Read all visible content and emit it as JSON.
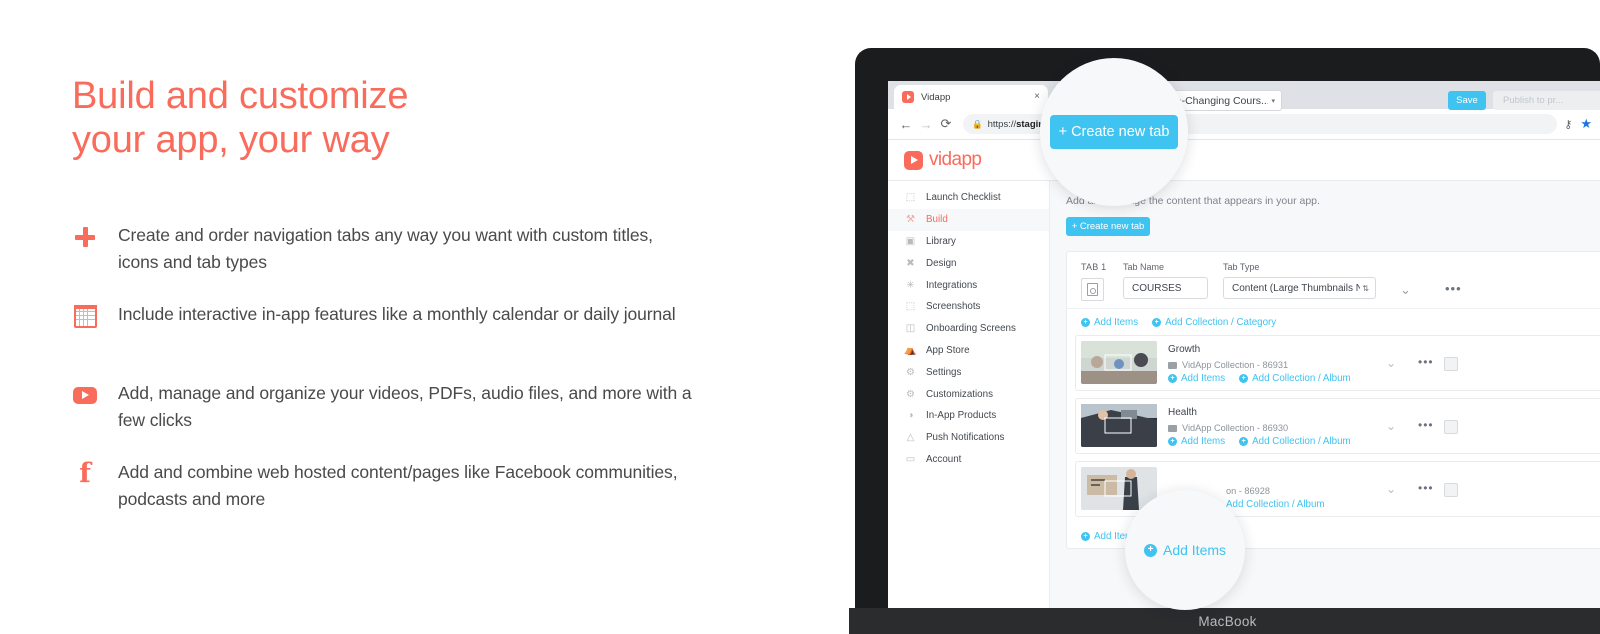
{
  "marketing": {
    "headline_line1": "Build and customize",
    "headline_line2": "your app, your way",
    "accent_color": "#f96b5b",
    "features": [
      {
        "icon": "plus-icon",
        "text": "Create and order navigation tabs any way you want with custom titles, icons and tab types"
      },
      {
        "icon": "calendar-icon",
        "text": "Include interactive in-app features like a monthly calendar or daily journal"
      },
      {
        "icon": "youtube-play-icon",
        "text": "Add, manage and organize your videos, PDFs, audio files, and more with a few clicks"
      },
      {
        "icon": "facebook-icon",
        "text": "Add and combine web hosted content/pages like Facebook communities, podcasts and more"
      }
    ]
  },
  "laptop": {
    "label": "MacBook"
  },
  "browser": {
    "tab_title": "Vidapp",
    "tab_close": "×",
    "back_icon": "←",
    "forward_icon": "→",
    "reload_icon": "⟳",
    "lock_icon": "🔒",
    "url_prefix": "https://",
    "url_bold": "stagin",
    "key_icon": "⚷",
    "star_icon": "★"
  },
  "app": {
    "logo_text": "vidapp",
    "app_selector": "...e-Changing Cours...",
    "selector_caret": "▾",
    "save_label": "Save",
    "publish_label": "Publish to pr...",
    "save_color": "#3fc3f0"
  },
  "sidebar": {
    "items": [
      {
        "label": "Launch Checklist",
        "icon": "checklist-icon",
        "glyph": "⬚",
        "active": false
      },
      {
        "label": "Build",
        "icon": "wrench-icon",
        "glyph": "⚒",
        "active": true
      },
      {
        "label": "Library",
        "icon": "library-icon",
        "glyph": "▣",
        "active": false
      },
      {
        "label": "Design",
        "icon": "design-icon",
        "glyph": "✖",
        "active": false
      },
      {
        "label": "Integrations",
        "icon": "integrations-icon",
        "glyph": "✳",
        "active": false
      },
      {
        "label": "Screenshots",
        "icon": "screenshots-icon",
        "glyph": "⬚",
        "active": false
      },
      {
        "label": "Onboarding Screens",
        "icon": "onboarding-icon",
        "glyph": "◫",
        "active": false
      },
      {
        "label": "App Store",
        "icon": "app-store-icon",
        "glyph": "⛺",
        "active": false
      },
      {
        "label": "Settings",
        "icon": "gear-icon",
        "glyph": "⚙",
        "active": false
      },
      {
        "label": "Customizations",
        "icon": "gear-icon",
        "glyph": "⚙",
        "active": false
      },
      {
        "label": "In-App Products",
        "icon": "products-icon",
        "glyph": "◑",
        "active": false
      },
      {
        "label": "Push Notifications",
        "icon": "bell-icon",
        "glyph": "△",
        "active": false
      },
      {
        "label": "Account",
        "icon": "lock-icon",
        "glyph": "▭",
        "active": false
      }
    ]
  },
  "main": {
    "description": "Add and manage the content that appears in your app.",
    "create_tab_label": "+ Create new tab",
    "tab": {
      "number_label": "TAB 1",
      "name_label": "Tab Name",
      "type_label": "Tab Type",
      "name_value": "COURSES",
      "type_value": "Content (Large Thumbnails No E",
      "type_caret": "⇅",
      "chevron": "⌄",
      "more": "•••",
      "links": [
        {
          "label": "Add Items",
          "plus": "+"
        },
        {
          "label": "Add Collection / Category",
          "plus": "+"
        }
      ]
    },
    "rows": [
      {
        "title": "Growth",
        "meta": "VidApp Collection - 86931",
        "links": [
          {
            "label": "Add Items",
            "plus": "+"
          },
          {
            "label": "Add Collection / Album",
            "plus": "+"
          }
        ],
        "chevron": "⌄",
        "more": "•••"
      },
      {
        "title": "Health",
        "meta": "VidApp Collection - 86930",
        "links": [
          {
            "label": "Add Items",
            "plus": "+"
          },
          {
            "label": "Add Collection / Album",
            "plus": "+"
          }
        ],
        "chevron": "⌄",
        "more": "•••"
      },
      {
        "title": "",
        "meta": "on - 86928",
        "links": [
          {
            "label": "Add Collection / Album",
            "plus": "+"
          }
        ],
        "chevron": "⌄",
        "more": "•••"
      }
    ],
    "bottom_link": {
      "label": "Add Items",
      "plus": "+"
    }
  },
  "callouts": {
    "create_tab": "+ Create new tab",
    "add_items": "Add Items",
    "add_items_plus": "+"
  }
}
